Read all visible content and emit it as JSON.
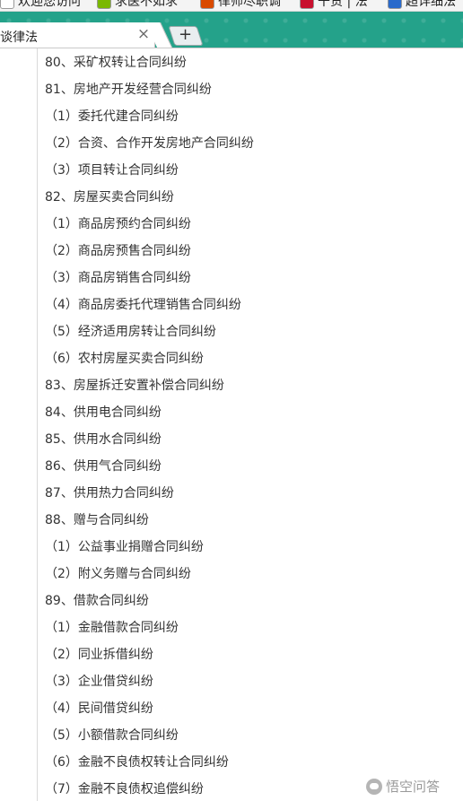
{
  "bookmarks": [
    {
      "label": "欢迎您访问",
      "icon": "page-icon",
      "color": "#ffffff"
    },
    {
      "label": "求医不如求",
      "icon": "leaf-icon",
      "color": "#7ab800"
    },
    {
      "label": "律师尽职调",
      "icon": "house-icon",
      "color": "#d94a00"
    },
    {
      "label": "干货 | 法",
      "icon": "hammer-sickle-icon",
      "color": "#c8102e"
    },
    {
      "label": "超详细法",
      "icon": "paw-icon",
      "color": "#2a6acb"
    }
  ],
  "tab": {
    "title": "谈律法",
    "close_glyph": "×",
    "new_tab_glyph": "+"
  },
  "theme": {
    "tabstrip_color": "#24a28a"
  },
  "list_items": [
    "80、采矿权转让合同纠纷",
    "81、房地产开发经营合同纠纷",
    "（1）委托代建合同纠纷",
    "（2）合资、合作开发房地产合同纠纷",
    "（3）项目转让合同纠纷",
    "82、房屋买卖合同纠纷",
    "（1）商品房预约合同纠纷",
    "（2）商品房预售合同纠纷",
    "（3）商品房销售合同纠纷",
    "（4）商品房委托代理销售合同纠纷",
    "（5）经济适用房转让合同纠纷",
    "（6）农村房屋买卖合同纠纷",
    "83、房屋拆迁安置补偿合同纠纷",
    "84、供用电合同纠纷",
    "85、供用水合同纠纷",
    "86、供用气合同纠纷",
    "87、供用热力合同纠纷",
    "88、赠与合同纠纷",
    "（1）公益事业捐赠合同纠纷",
    "（2）附义务赠与合同纠纷",
    "89、借款合同纠纷",
    "（1）金融借款合同纠纷",
    "（2）同业拆借纠纷",
    "（3）企业借贷纠纷",
    "（4）民间借贷纠纷",
    "（5）小额借款合同纠纷",
    "（6）金融不良债权转让合同纠纷",
    "（7）金融不良债权追偿纠纷"
  ],
  "watermark": {
    "text": "悟空问答",
    "icon": "wukong-logo-icon"
  }
}
